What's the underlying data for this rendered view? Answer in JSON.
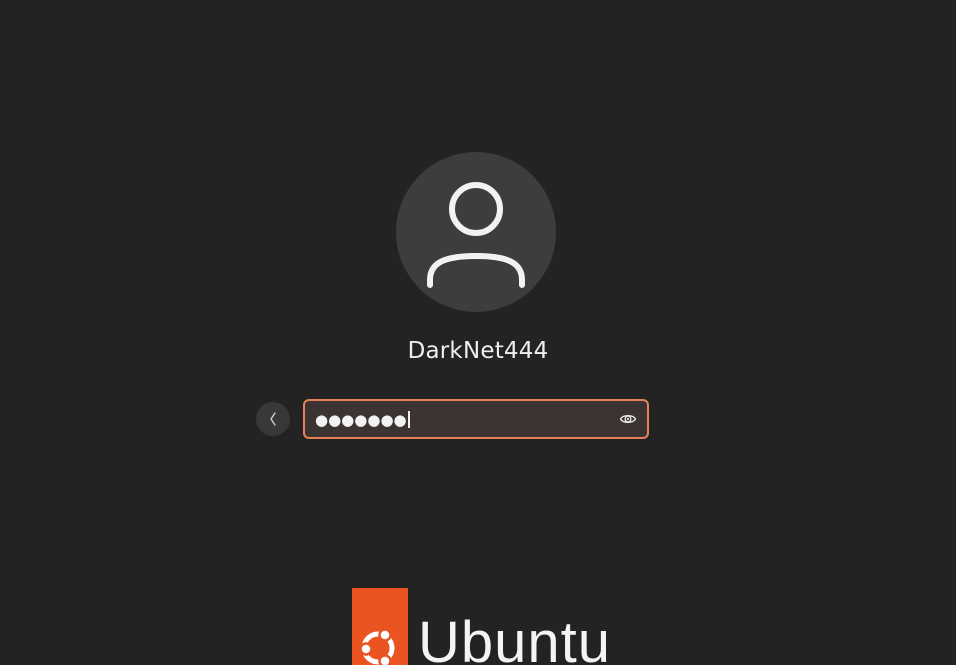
{
  "login": {
    "username": "DarkNet444",
    "password_masked": "●●●●●●●",
    "avatar_icon": "user-icon",
    "back_icon": "chevron-left-icon",
    "reveal_icon": "eye-icon"
  },
  "branding": {
    "logo_text": "Ubuntu",
    "logo_icon": "ubuntu-circle-of-friends-icon"
  },
  "colors": {
    "background": "#232323",
    "accent": "#e95420",
    "focus_border": "#e8805a",
    "avatar_bg": "#3d3d3d"
  }
}
